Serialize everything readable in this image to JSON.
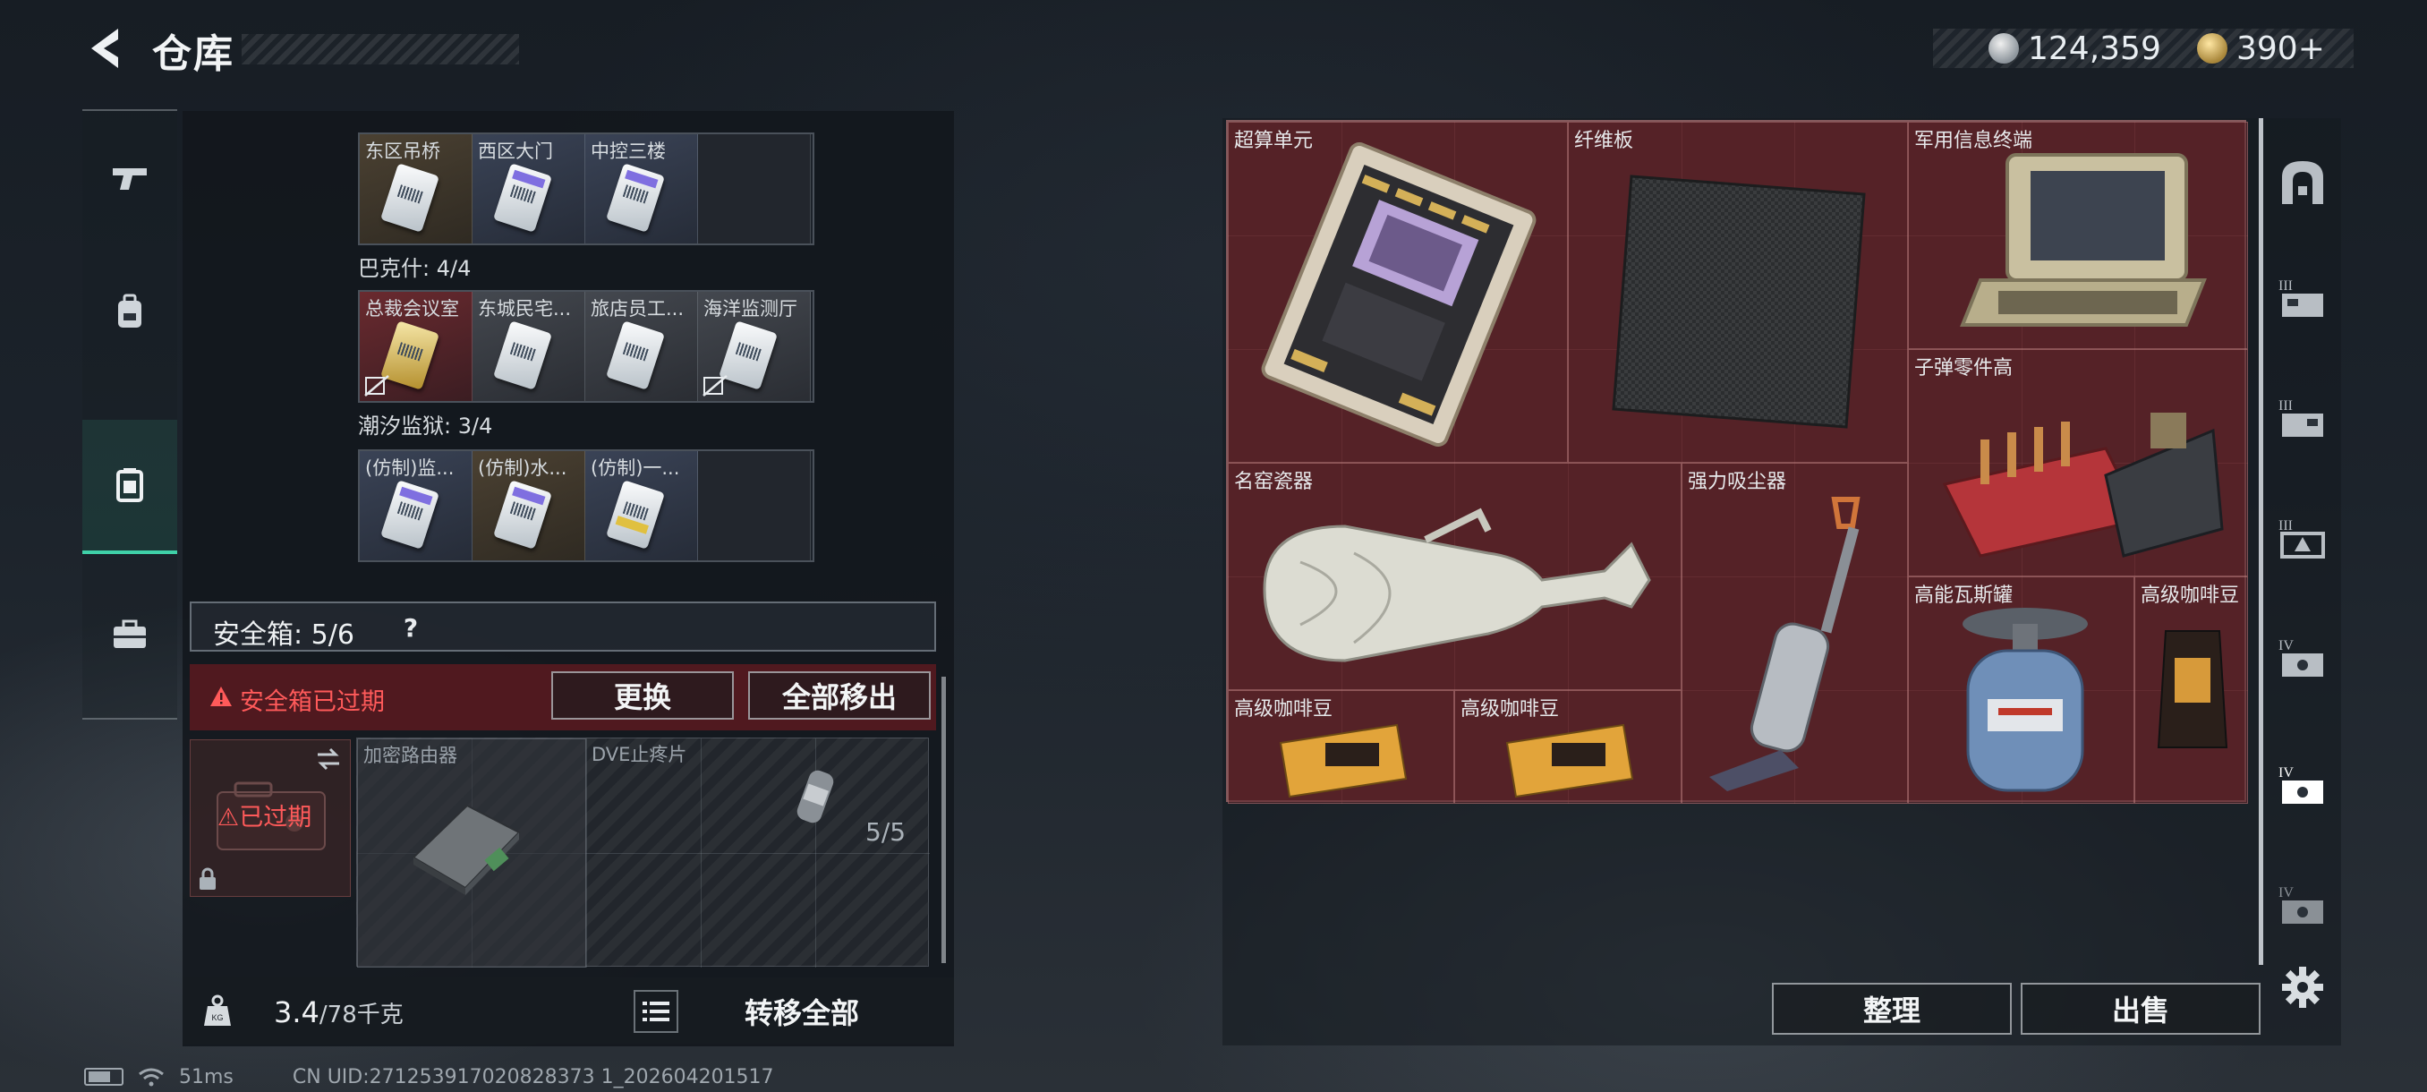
{
  "header": {
    "title": "仓库",
    "silver": "124,359",
    "gold": "390+"
  },
  "left_panel": {
    "collections": [
      {
        "title": "",
        "cells": [
          "东区吊桥",
          "西区大门",
          "中控三楼",
          ""
        ]
      },
      {
        "title": "巴克什: 4/4",
        "cells": [
          "总裁会议室",
          "东城民宅...",
          "旅店员工...",
          "海洋监测厅"
        ]
      },
      {
        "title": "潮汐监狱: 3/4",
        "cells": [
          "(仿制)监...",
          "(仿制)水...",
          "(仿制)一...",
          ""
        ]
      }
    ],
    "safe_box": {
      "title": "安全箱: 5/6",
      "help": "?",
      "alert": "安全箱已过期",
      "replace_label": "更换",
      "move_all_out_label": "全部移出",
      "expired_label": "已过期",
      "slots": [
        {
          "name": "加密路由器"
        },
        {
          "name": "DVE止疼片",
          "count": "5/5"
        }
      ]
    },
    "footer": {
      "weight": "3.4",
      "capacity": "/78千克",
      "transfer_all": "转移全部"
    }
  },
  "status": {
    "ping": "51ms",
    "uid": "CN UID:271253917020828373 1_202604201517"
  },
  "stash": {
    "items": [
      {
        "name": "超算单元"
      },
      {
        "name": "纤维板"
      },
      {
        "name": "军用信息终端"
      },
      {
        "name": "子弹零件高"
      },
      {
        "name": "名窑瓷器"
      },
      {
        "name": "强力吸尘器"
      },
      {
        "name": "高能瓦斯罐"
      },
      {
        "name": "高级咖啡豆"
      },
      {
        "name": "高级咖啡豆"
      },
      {
        "name": "高级咖啡豆"
      }
    ],
    "sort_label": "整理",
    "sell_label": "出售"
  },
  "colors": {
    "accent": "#3fd1a8",
    "alert": "#ff5a5a",
    "stash_bg": "#4a1f24"
  }
}
